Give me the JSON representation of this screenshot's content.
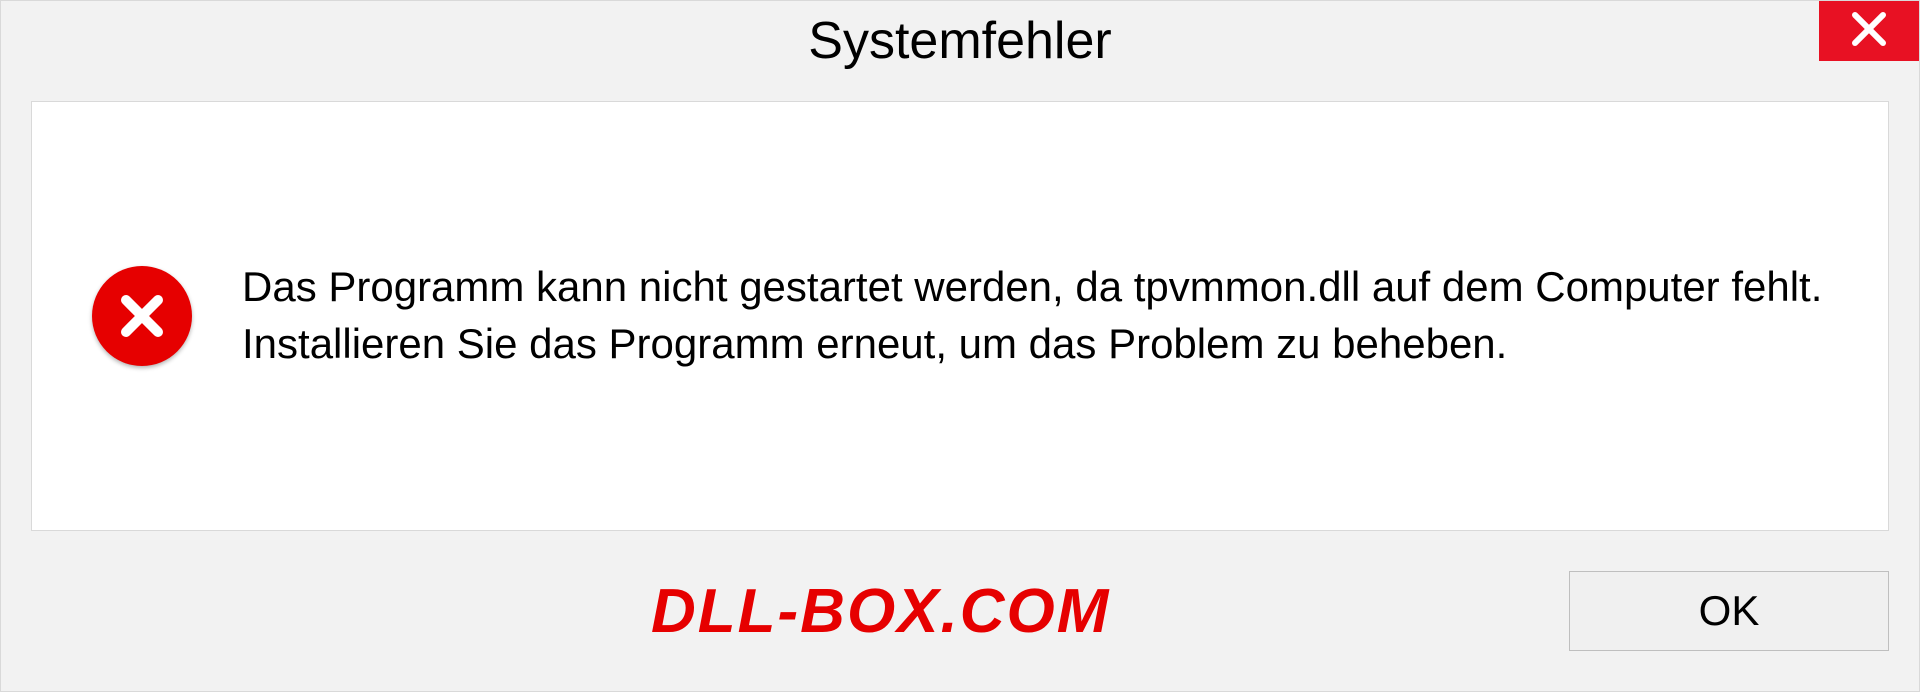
{
  "dialog": {
    "title": "Systemfehler",
    "message": "Das Programm kann nicht gestartet werden, da tpvmmon.dll auf dem Computer fehlt. Installieren Sie das Programm erneut, um das Problem zu beheben.",
    "ok_label": "OK"
  },
  "watermark": "DLL-BOX.COM",
  "colors": {
    "close_bg": "#e81123",
    "error_bg": "#e60000",
    "panel_bg": "#f2f2f2"
  }
}
